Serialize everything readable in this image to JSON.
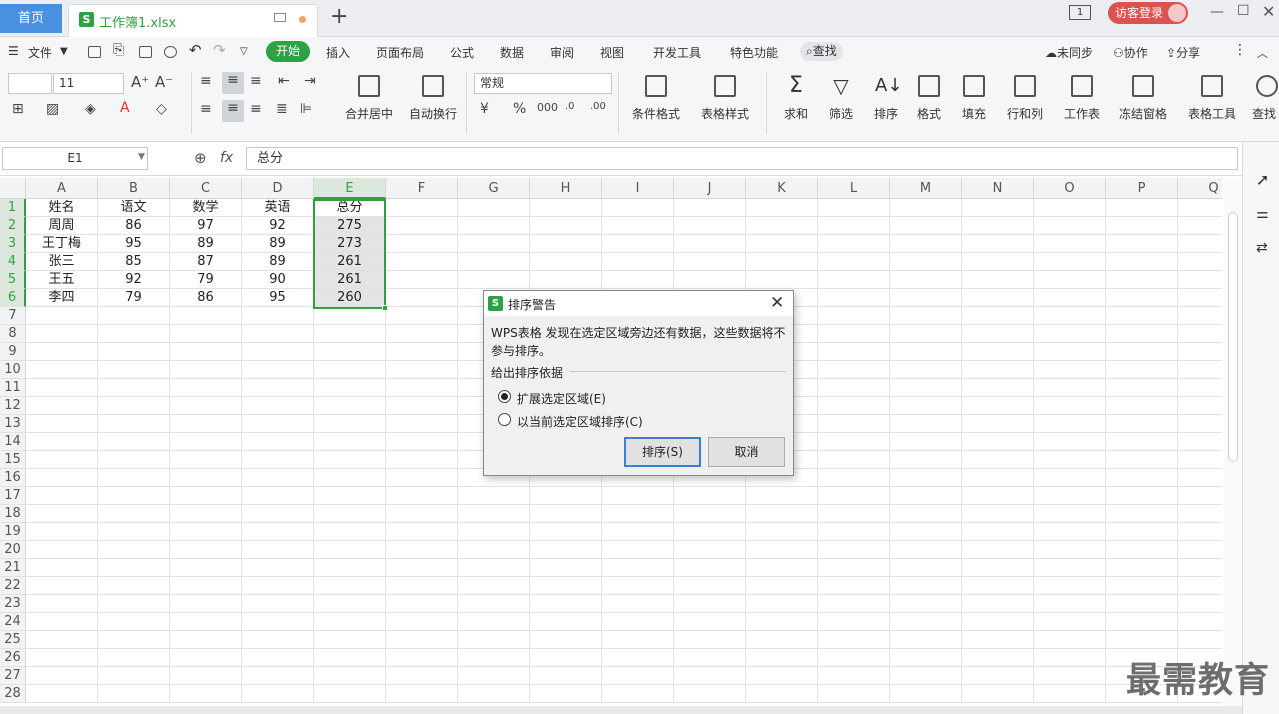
{
  "titlebar": {
    "home_tab": "首页",
    "doc_tab": "工作簿1.xlsx",
    "new_tab": "+",
    "page_indicator": "1",
    "login": "访客登录"
  },
  "menubar": {
    "file": "文件",
    "tabs": [
      "开始",
      "插入",
      "页面布局",
      "公式",
      "数据",
      "审阅",
      "视图",
      "开发工具",
      "特色功能"
    ],
    "search": "查找",
    "right": [
      "未同步",
      "协作",
      "分享"
    ]
  },
  "ribbon": {
    "font_size": "11",
    "number_format": "常规",
    "merge": "合并居中",
    "wrap": "自动换行",
    "cond_format": "条件格式",
    "table_style": "表格样式",
    "sum": "求和",
    "filter": "筛选",
    "sort": "排序",
    "format": "格式",
    "fill": "填充",
    "rowcol": "行和列",
    "sheet": "工作表",
    "freeze": "冻结窗格",
    "tools": "表格工具",
    "find": "查找"
  },
  "formula_bar": {
    "cell_ref": "E1",
    "fx": "fx",
    "value": "总分"
  },
  "sheet": {
    "columns": [
      "A",
      "B",
      "C",
      "D",
      "E",
      "F",
      "G",
      "H",
      "I",
      "J",
      "K",
      "L",
      "M",
      "N",
      "O",
      "P",
      "Q"
    ],
    "rows": [
      "1",
      "2",
      "3",
      "4",
      "5",
      "6",
      "7",
      "8",
      "9",
      "10",
      "11",
      "12",
      "13",
      "14",
      "15",
      "16",
      "17",
      "18",
      "19",
      "20",
      "21",
      "22",
      "23",
      "24",
      "25",
      "26",
      "27",
      "28"
    ],
    "data": [
      [
        "姓名",
        "语文",
        "数学",
        "英语",
        "总分"
      ],
      [
        "周周",
        "86",
        "97",
        "92",
        "275"
      ],
      [
        "王丁梅",
        "95",
        "89",
        "89",
        "273"
      ],
      [
        "张三",
        "85",
        "87",
        "89",
        "261"
      ],
      [
        "王五",
        "92",
        "79",
        "90",
        "261"
      ],
      [
        "李四",
        "79",
        "86",
        "95",
        "260"
      ]
    ]
  },
  "dialog": {
    "title": "排序警告",
    "message": "WPS表格 发现在选定区域旁边还有数据，这些数据将不参与排序。",
    "group_label": "给出排序依据",
    "option1": "扩展选定区域(E)",
    "option2": "以当前选定区域排序(C)",
    "ok": "排序(S)",
    "cancel": "取消"
  },
  "watermark": "最需教育",
  "colors": {
    "accent": "#2ea243",
    "home_tab": "#4a90e2",
    "login": "#d9534f"
  }
}
